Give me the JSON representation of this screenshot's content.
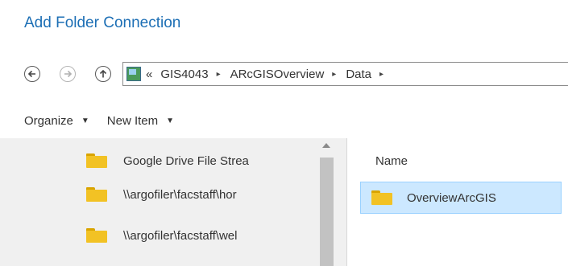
{
  "dialog": {
    "title": "Add Folder Connection"
  },
  "nav": {
    "back_icon": "back-arrow-icon",
    "forward_icon": "forward-arrow-icon",
    "up_icon": "up-arrow-icon"
  },
  "address": {
    "overflow": "«",
    "segments": [
      "GIS4043",
      "ARcGISOverview",
      "Data"
    ],
    "separator": "▸"
  },
  "toolbar": {
    "organize_label": "Organize",
    "new_item_label": "New Item",
    "caret": "▼"
  },
  "tree": {
    "items": [
      {
        "label": "Google Drive File Strea"
      },
      {
        "label": "\\\\argofiler\\facstaff\\hor"
      },
      {
        "label": "\\\\argofiler\\facstaff\\wel"
      }
    ]
  },
  "content": {
    "column_header": "Name",
    "rows": [
      {
        "label": "OverviewArcGIS"
      }
    ]
  },
  "colors": {
    "title": "#1d6fb5",
    "selection_bg": "#cce8ff",
    "folder": "#f2c224"
  }
}
